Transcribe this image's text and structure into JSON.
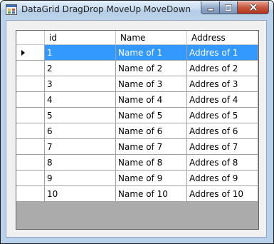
{
  "window": {
    "title": "DataGrid DragDrop MoveUp MoveDown"
  },
  "icons": {
    "app": "app-form-icon",
    "minimize": "minimize-icon",
    "maximize": "maximize-icon",
    "close": "close-icon",
    "current_row": "current-row-arrow-icon"
  },
  "grid": {
    "columns": [
      "id",
      "Name",
      "Address"
    ],
    "selected_row_index": 0,
    "rows": [
      [
        "1",
        "Name of 1",
        "Addres of 1"
      ],
      [
        "2",
        "Name of 2",
        "Addres of 2"
      ],
      [
        "3",
        "Name of 3",
        "Addres of 3"
      ],
      [
        "4",
        "Name of 4",
        "Addres of 4"
      ],
      [
        "5",
        "Name of 5",
        "Addres of 5"
      ],
      [
        "6",
        "Name of 6",
        "Addres of 6"
      ],
      [
        "7",
        "Name of 7",
        "Addres of 7"
      ],
      [
        "8",
        "Name of 8",
        "Addres of 8"
      ],
      [
        "9",
        "Name of 9",
        "Addres of 9"
      ],
      [
        "10",
        "Name of 10",
        "Addres of 10"
      ]
    ]
  },
  "colors": {
    "selection": "#3399ff",
    "grid_background": "#ababab",
    "close_button": "#c7573e"
  }
}
